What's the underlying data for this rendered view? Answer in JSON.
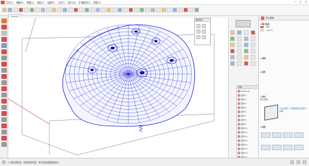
{
  "window": {
    "menu": [
      "文件(F)",
      "编辑(E)",
      "视图(V)",
      "相机(C)",
      "绘图(R)",
      "工具(T)",
      "窗口(W)",
      "扩展程序(x)",
      "帮助(H)"
    ],
    "controls": [
      "—",
      "☐",
      "✕"
    ]
  },
  "scene_tab": {
    "label": "Scene1"
  },
  "popup": {
    "title": "模型组件"
  },
  "mid_panel": {
    "title": "组件",
    "items": [
      "Freeze all",
      "组件 2",
      "组件 3",
      "组件 4",
      "组件 5",
      "组件 6",
      "组件 7",
      "组件 8",
      "组件 9",
      "组件 10",
      "组件 11",
      "组件 12",
      "组件 13",
      "组件 14",
      "组件 15",
      "组件 16",
      "组件 17"
    ]
  },
  "tray": {
    "title": "默认面板",
    "entity_title": "▸ 图元信息",
    "material_title": "▸ 材料",
    "material_name": "蓝色",
    "layer_label": "Layer0",
    "tag_label": "标记",
    "components_title": "▸ 组件",
    "styles_title": "▸ 样式",
    "styles_name": "默认样式",
    "blue_text": "以空白背景、平滑面及默认的设计风格",
    "scenes_title": "▸ 场景"
  },
  "status": {
    "text": "① 单击或拖动，切换选择状态；单击边线或拖拽显示。"
  },
  "colors": {
    "mesh": "#1a1ad9",
    "accent": "#e06a3c"
  }
}
